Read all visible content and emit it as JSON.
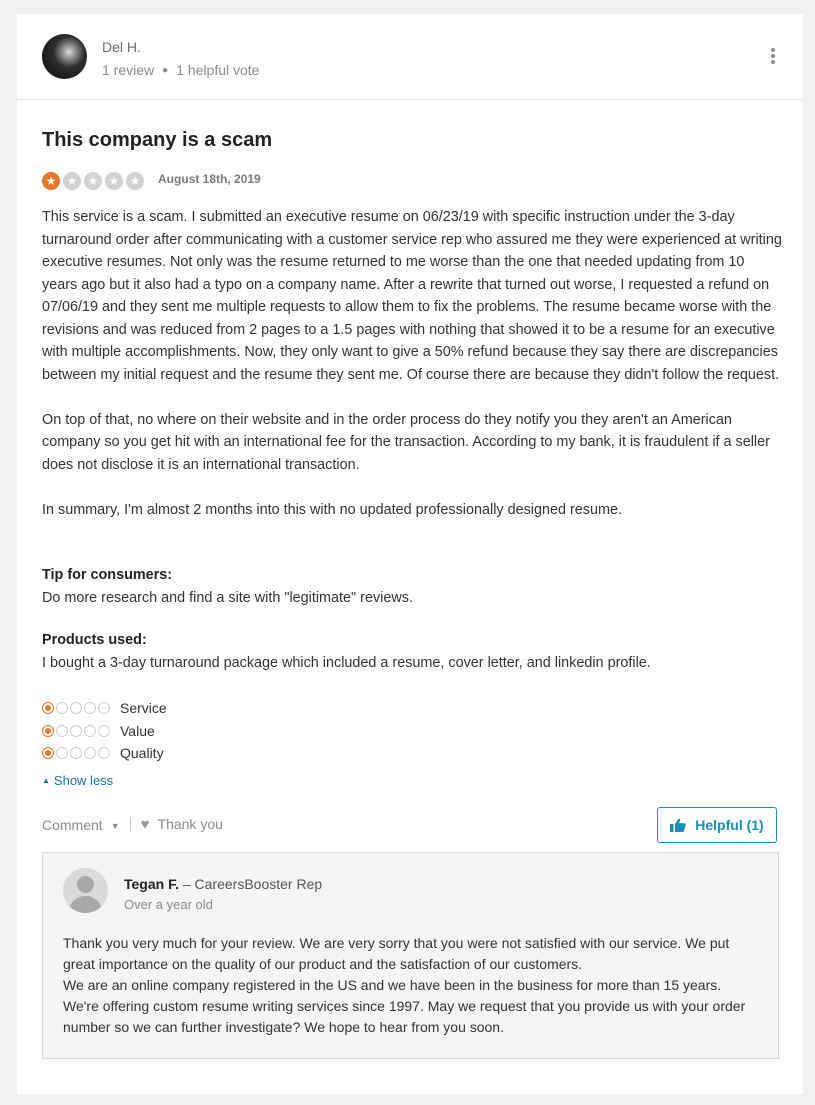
{
  "reviewer": {
    "name": "Del H.",
    "reviews": "1 review",
    "votes": "1 helpful vote"
  },
  "review": {
    "title": "This company is a scam",
    "rating": 1,
    "rating_max": 5,
    "date": "August 18th, 2019",
    "paragraphs": [
      "This service is a scam. I submitted an executive resume on 06/23/19 with specific instruction under the 3-day turnaround order after communicating with a customer service rep who assured me they were experienced at writing executive resumes. Not only was the resume returned to me worse than the one that needed updating from 10 years ago but it also had a typo on a company name. After a rewrite that turned out worse, I requested a refund on 07/06/19 and they sent me multiple requests to allow them to fix the problems. The resume became worse with the revisions and was reduced from 2 pages to a 1.5 pages with nothing that showed it to be a resume for an executive with multiple accomplishments. Now, they only want to give a 50% refund because they say there are discrepancies between my initial request and the resume they sent me. Of course there are because they didn't follow the request.",
      "On top of that, no where on their website and in the order process do they notify you they aren't an American company so you get hit with an international fee for the transaction. According to my bank, it is fraudulent if a seller does not disclose it is an international transaction.",
      "In summary, I'm almost 2 months into this with no updated professionally designed resume."
    ],
    "tip_label": "Tip for consumers:",
    "tip_text": "Do more research and find a site with \"legitimate\" reviews.",
    "products_label": "Products used:",
    "products_text": "I bought a 3-day turnaround package which included a resume, cover letter, and linkedin profile.",
    "sub_ratings": [
      {
        "label": "Service",
        "rating": 1
      },
      {
        "label": "Value",
        "rating": 1
      },
      {
        "label": "Quality",
        "rating": 1
      }
    ],
    "show_less": "Show less"
  },
  "actions": {
    "comment": "Comment",
    "thank_you": "Thank you",
    "helpful": "Helpful (1)"
  },
  "reply": {
    "name": "Tegan F.",
    "role": "– CareersBooster Rep",
    "date": "Over a year old",
    "lines": [
      "Thank you very much for your review. We are very sorry that you were not satisfied with our service. We put",
      "great importance on the quality of our product and the satisfaction of our customers.",
      "We are an online company registered in the US and we have been in the business for more than 15 years.",
      "We're offering custom resume writing services since 1997. May we request that you provide us with your order",
      "number so we can further investigate? We hope to hear from you soon."
    ]
  },
  "colors": {
    "star_active": "#e4782b",
    "star_inactive": "#d2d2d2",
    "link": "#1a6fa5",
    "helpful_accent": "#1a8fb5"
  }
}
